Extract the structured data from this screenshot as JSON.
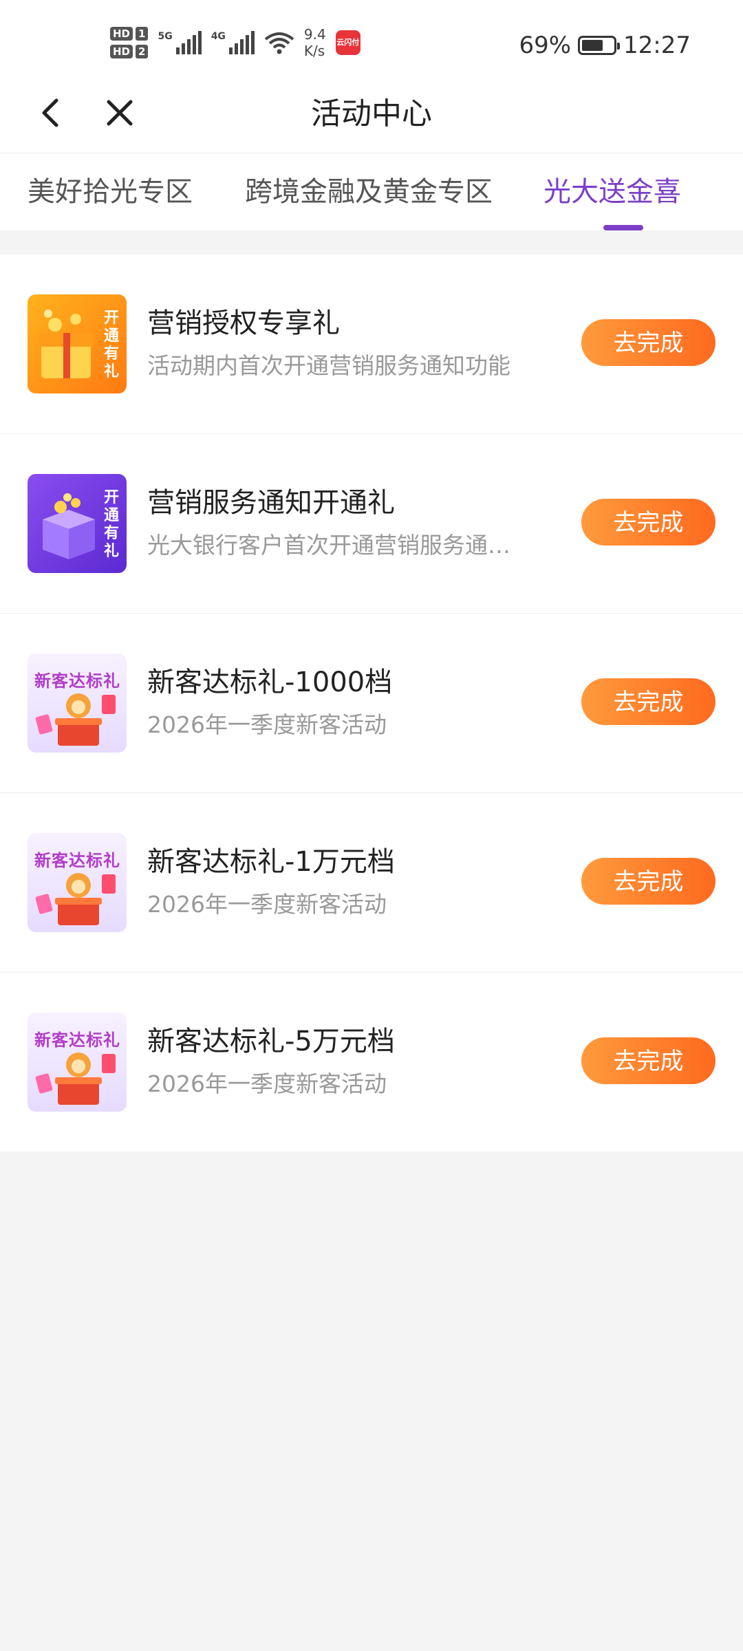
{
  "status_bar": {
    "hd1": "HD",
    "sim1": "1",
    "hd2": "HD",
    "sim2": "2",
    "net1": "5G",
    "net2": "4G",
    "rate_value": "9.4",
    "rate_unit": "K/s",
    "app_badge_text": "云闪付",
    "battery_text": "69%",
    "battery_level": 0.69,
    "time": "12:27"
  },
  "header": {
    "title": "活动中心",
    "back_icon": "chevron-left-icon",
    "close_icon": "close-icon"
  },
  "tabs": [
    {
      "label": "美好拾光专区",
      "active": false
    },
    {
      "label": "跨境金融及黄金专区",
      "active": false
    },
    {
      "label": "光大送金喜",
      "active": true
    }
  ],
  "accent_color": "#7b3fc6",
  "button_color": "#ff7a28",
  "activities": [
    {
      "title": "营销授权专享礼",
      "desc": "活动期内首次开通营销服务通知功能",
      "button": "去完成",
      "thumb_text": "开通有礼"
    },
    {
      "title": "营销服务通知开通礼",
      "desc": "光大银行客户首次开通营销服务通知功能",
      "button": "去完成",
      "thumb_text": "开通有礼"
    },
    {
      "title": "新客达标礼-1000档",
      "desc": "2026年一季度新客活动",
      "button": "去完成",
      "thumb_text": "新客达标礼"
    },
    {
      "title": "新客达标礼-1万元档",
      "desc": "2026年一季度新客活动",
      "button": "去完成",
      "thumb_text": "新客达标礼"
    },
    {
      "title": "新客达标礼-5万元档",
      "desc": "2026年一季度新客活动",
      "button": "去完成",
      "thumb_text": "新客达标礼"
    }
  ]
}
